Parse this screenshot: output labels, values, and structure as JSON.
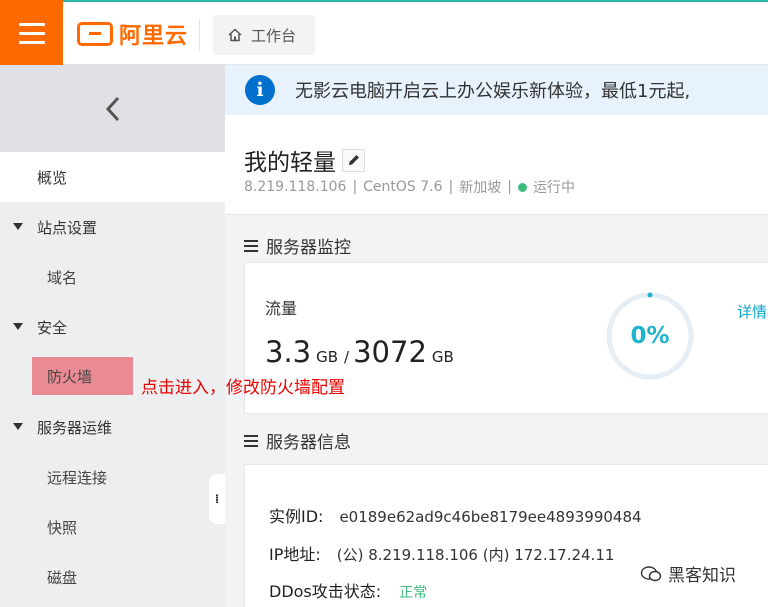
{
  "topbar": {
    "brand": "阿里云",
    "workbench_label": "工作台"
  },
  "sidebar": {
    "items": [
      {
        "label": "概览"
      },
      {
        "label": "站点设置"
      },
      {
        "label": "域名"
      },
      {
        "label": "安全"
      },
      {
        "label": "防火墙"
      },
      {
        "label": "服务器运维"
      },
      {
        "label": "远程连接"
      },
      {
        "label": "快照"
      },
      {
        "label": "磁盘"
      }
    ],
    "annotation": "点击进入，修改防火墙配置",
    "collapse_glyph": "⁞"
  },
  "banner": {
    "text": "无影云电脑开启云上办公娱乐新体验，最低1元起,"
  },
  "server": {
    "title": "我的轻量",
    "ip": "8.219.118.106",
    "os": "CentOS 7.6",
    "region": "新加坡",
    "status": "运行中"
  },
  "monitor": {
    "section_title": "服务器监控",
    "traffic_label": "流量",
    "used": "3.3",
    "used_unit": "GB",
    "slash": "/",
    "total": "3072",
    "total_unit": "GB",
    "percent": "0%",
    "detail_link": "详情"
  },
  "info": {
    "section_title": "服务器信息",
    "instance_key": "实例ID:",
    "instance_val": "e0189e62ad9c46be8179ee4893990484",
    "ip_key": "IP地址:",
    "ip_val": "(公) 8.219.118.106 (内) 172.17.24.11",
    "ddos_key": "DDos攻击状态:",
    "ddos_val": "正常"
  },
  "watermark": {
    "text": "黑客知识"
  },
  "colors": {
    "brand_orange": "#ff6a00",
    "accent_teal": "#1eb4cc",
    "status_green": "#3dbd7d",
    "annotation_red": "#ee0000"
  }
}
